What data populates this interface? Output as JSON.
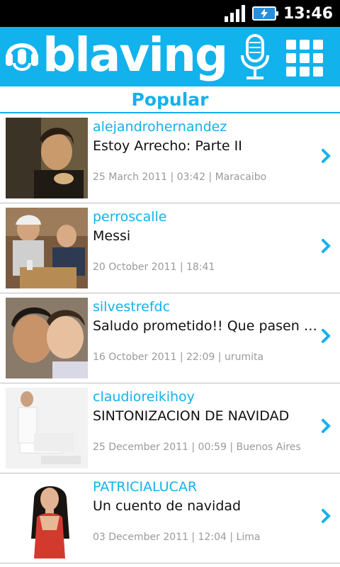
{
  "status_bar": {
    "time": "13:46"
  },
  "app": {
    "brand": "blaving",
    "mic_icon": "microphone-icon",
    "menu_icon": "grid-menu-icon",
    "accent": "#12b2ec"
  },
  "section": {
    "title": "Popular"
  },
  "items": [
    {
      "username": "alejandrohernandez",
      "title": "Estoy Arrecho: Parte II",
      "meta": "25 March 2011 | 03:42 | Maracaibo"
    },
    {
      "username": "perroscalle",
      "title": "Messi",
      "meta": "20 October 2011 | 18:41"
    },
    {
      "username": "silvestrefdc",
      "title": "Saludo prometido!! Que pasen F...",
      "meta": "16 October 2011 | 22:09 | urumita"
    },
    {
      "username": "claudioreikihoy",
      "title": "SINTONIZACION DE NAVIDAD",
      "meta": "25 December 2011 | 00:59 | Buenos Aires"
    },
    {
      "username": "PATRICIALUCAR",
      "title": "Un cuento de navidad",
      "meta": "03 December 2011 | 12:04 | Lima"
    }
  ]
}
